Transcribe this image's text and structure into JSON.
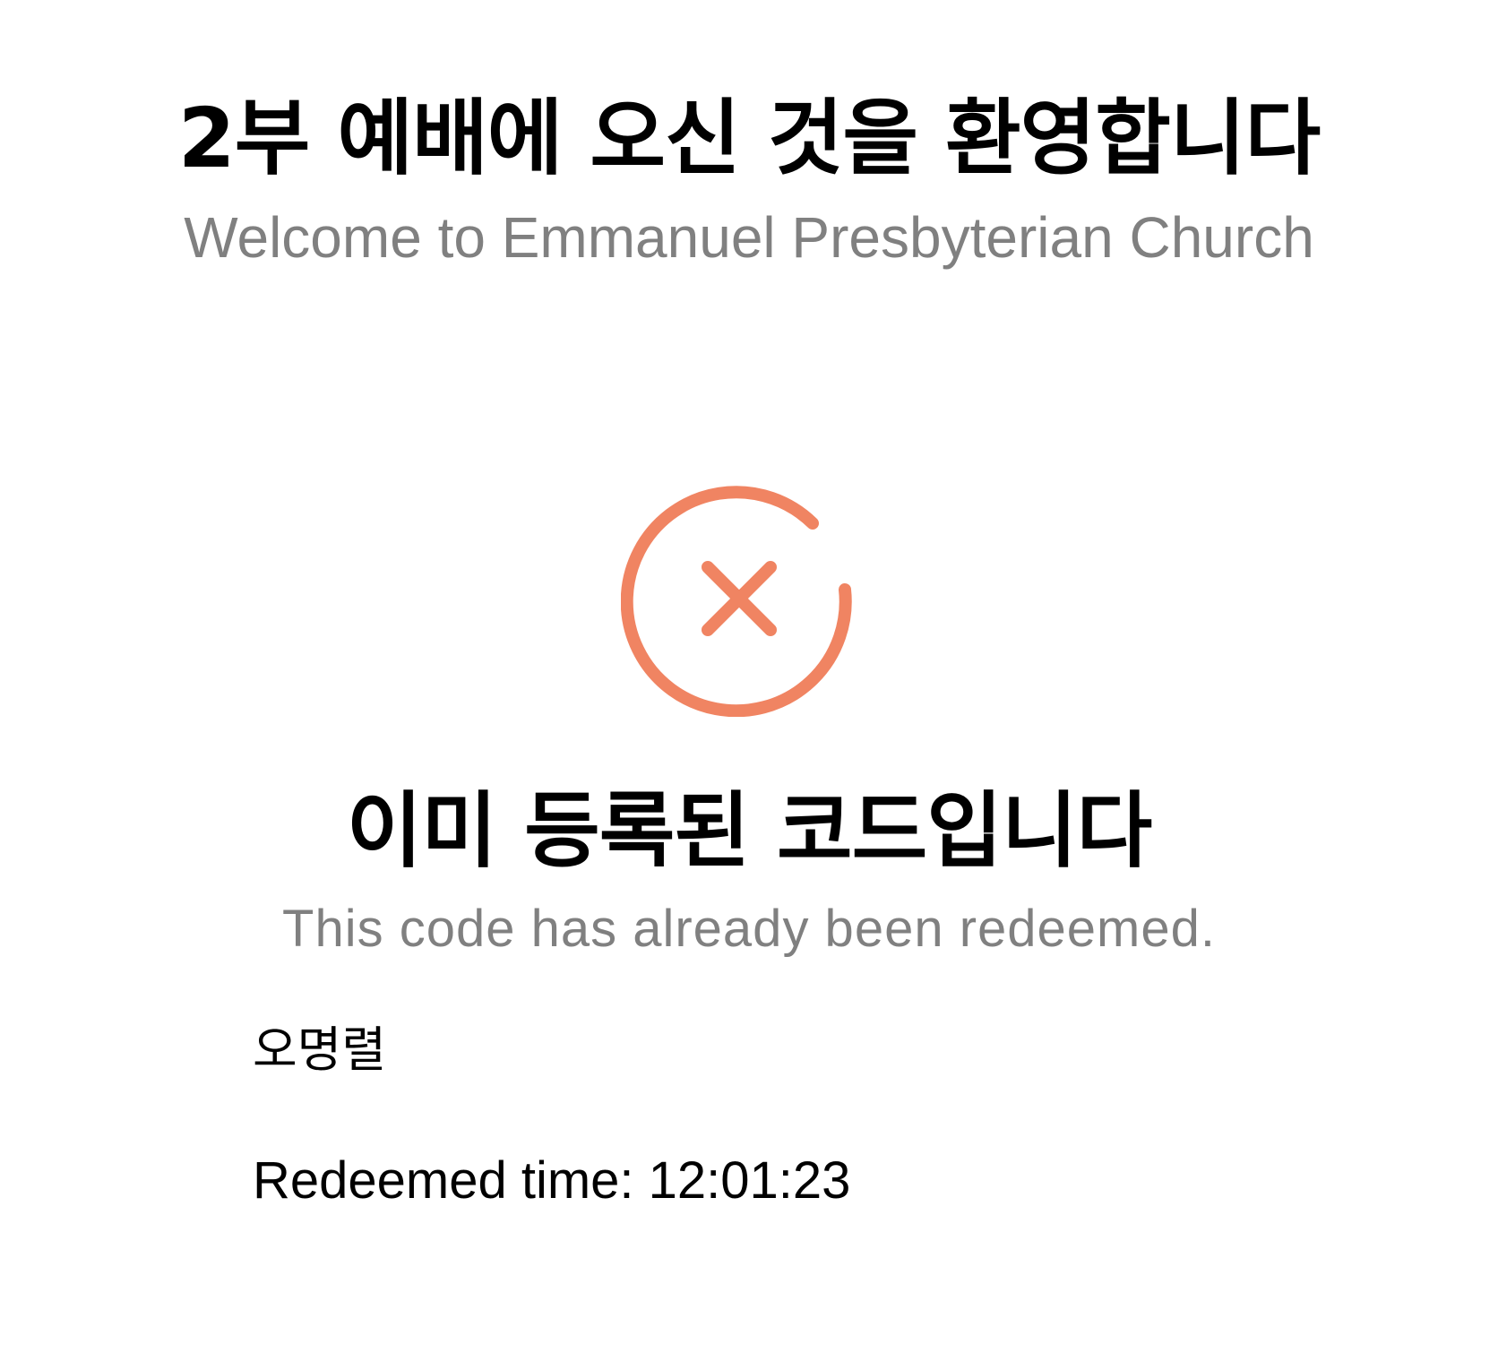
{
  "header": {
    "title": "2부 예배에 오신 것을 환영합니다",
    "subtitle": "Welcome to Emmanuel Presbyterian Church"
  },
  "status": {
    "icon": "error-circle-x-icon",
    "title": "이미 등록된 코드입니다",
    "message": "This code has already been redeemed.",
    "color": "#F08462"
  },
  "details": {
    "name": "오명렬",
    "redeemed_time": "Redeemed time: 12:01:23"
  }
}
